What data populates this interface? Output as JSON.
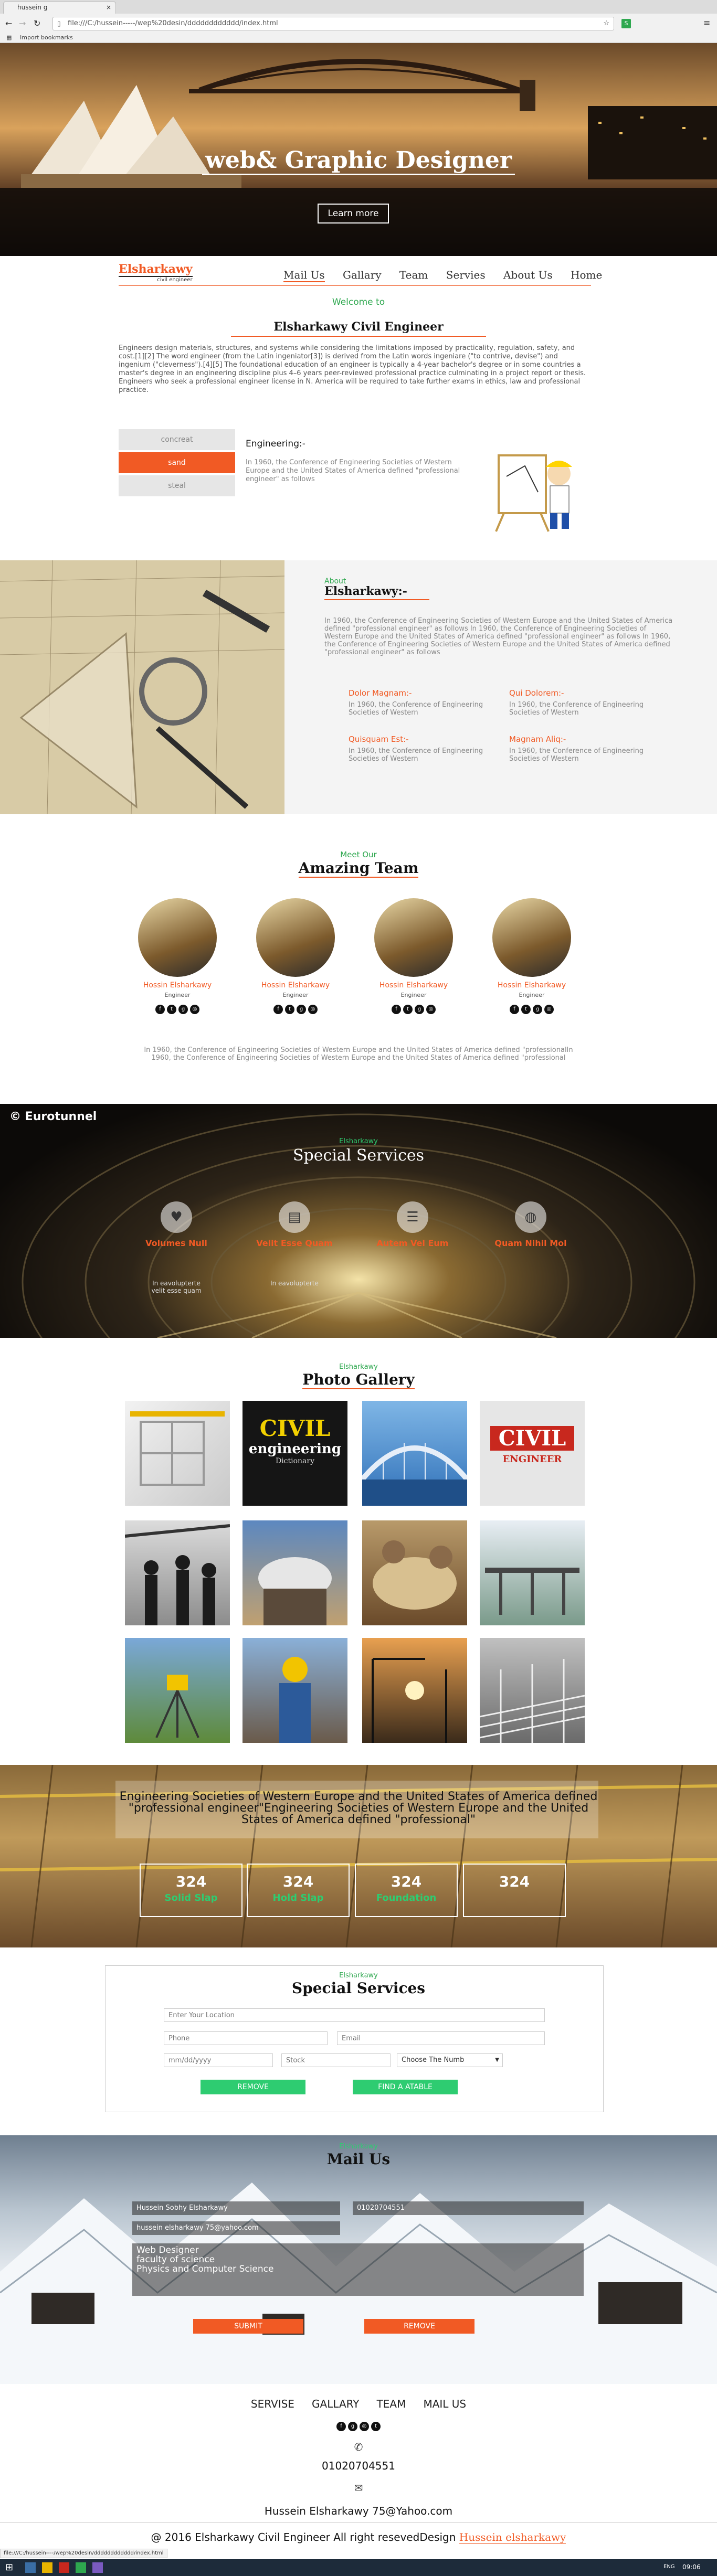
{
  "browser": {
    "tab_title": "hussein g",
    "address": "file:///C:/hussein-----/wep%20desin/dddddddddddd/index.html",
    "bookmark": "Import bookmarks"
  },
  "hero": {
    "title": "web& Graphic Designer",
    "learn_more": "Learn more"
  },
  "nav": {
    "logo": "Elsharkawy",
    "logo_sub": "civil engineer",
    "items": [
      "Mail Us",
      "Gallary",
      "Team",
      "Servies",
      "About Us",
      "Home"
    ]
  },
  "welcome": {
    "kicker": "Welcome to",
    "title": "Elsharkawy Civil Engineer",
    "paragraph": "Engineers design materials, structures, and systems while considering the limitations imposed by practicality, regulation, safety, and cost.[1][2] The word engineer (from the Latin ingeniator[3]) is derived from the Latin words ingeniare (\"to contrive, devise\") and ingenium (\"cleverness\").[4][5] The foundational education of an engineer is typically a 4-year bachelor's degree or in some countries a master's degree in an engineering discipline plus 4–6 years peer-reviewed professional practice culminating in a project report or thesis. Engineers who seek a professional engineer license in N. America will be required to take further exams in ethics, law and professional practice."
  },
  "tabs": {
    "items": [
      "concreat",
      "sand",
      "steal"
    ],
    "active_index": 1,
    "heading": "Engineering:-",
    "text": "In 1960, the Conference of Engineering Societies of Western Europe and the United States of America defined \"professional engineer\" as follows"
  },
  "about": {
    "kicker": "About",
    "title": "Elsharkawy:-",
    "paragraph": "In 1960, the Conference of Engineering Societies of Western Europe and the United States of America defined \"professional engineer\" as follows In 1960, the Conference of Engineering Societies of Western Europe and the United States of America defined \"professional engineer\" as follows In 1960, the Conference of Engineering Societies of Western Europe and the United States of America defined \"professional engineer\" as follows",
    "features": [
      {
        "title": "Dolor Magnam:-",
        "text": "In 1960, the Conference of Engineering Societies of Western"
      },
      {
        "title": "Qui Dolorem:-",
        "text": "In 1960, the Conference of Engineering Societies of Western"
      },
      {
        "title": "Quisquam Est:-",
        "text": "In 1960, the Conference of Engineering Societies of Western"
      },
      {
        "title": "Magnam Aliq:-",
        "text": "In 1960, the Conference of Engineering Societies of Western"
      }
    ]
  },
  "team": {
    "kicker": "Meet Our",
    "title": "Amazing Team",
    "members": [
      {
        "name": "Hossin Elsharkawy",
        "role": "Engineer"
      },
      {
        "name": "Hossin Elsharkawy",
        "role": "Engineer"
      },
      {
        "name": "Hossin Elsharkawy",
        "role": "Engineer"
      },
      {
        "name": "Hossin Elsharkawy",
        "role": "Engineer"
      }
    ],
    "paragraph": "In 1960, the Conference of Engineering Societies of Western Europe and the United States of America defined \"professionalIn 1960, the Conference of Engineering Societies of Western Europe and the United States of America defined \"professional"
  },
  "services": {
    "watermark": "© Eurotunnel",
    "kicker": "Elsharkawy",
    "title": "Special Services",
    "items": [
      {
        "title": "Volumes Null",
        "text": "In eavolupterte velit esse quam"
      },
      {
        "title": "Velit Esse Quam",
        "text": "In eavolupterte"
      },
      {
        "title": "Autem Vel Eum",
        "text": ""
      },
      {
        "title": "Quam Nihil Mol",
        "text": ""
      }
    ]
  },
  "gallery": {
    "kicker": "Elsharkawy",
    "title": "Photo Gallery",
    "tile_texts": [
      "CIVIL",
      "engineering",
      "Dictionary",
      "CIVIL",
      "ENGINEER"
    ]
  },
  "stats": {
    "heading": "Engineering Societies of Western Europe and the United States of America defined \"professional engineer\"Engineering Societies of Western Europe and the United States of America defined \"professional\"",
    "items": [
      {
        "value": "324",
        "label": "Solid Slap"
      },
      {
        "value": "324",
        "label": "Hold Slap"
      },
      {
        "value": "324",
        "label": "Foundation"
      },
      {
        "value": "324",
        "label": ""
      }
    ]
  },
  "form1": {
    "kicker": "Elsharkawy",
    "title": "Special Services",
    "location_ph": "Enter Your Location",
    "phone_ph": "Phone",
    "email_ph": "Email",
    "date_ph": "mm/dd/yyyy",
    "stock_ph": "Stock",
    "select_value": "Choose The Numb",
    "remove": "REMOVE",
    "find": "FIND A ATABLE"
  },
  "mail": {
    "kicker": "Elsharkawy",
    "title": "Mail Us",
    "name_val": "Hussein Sobhy Elsharkawy",
    "phone_val": "01020704551",
    "email_val": "hussein elsharkawy 75@yahoo.com",
    "message_lines": [
      "Web Designer",
      "faculty of science",
      "Physics and Computer Science"
    ],
    "submit": "SUBMIT",
    "remove": "REMOVE"
  },
  "footer": {
    "nav": [
      "SERVISE",
      "GALLARY",
      "TEAM",
      "MAIL US"
    ],
    "phone": "01020704551",
    "email": "Hussein Elsharkawy 75@Yahoo.com",
    "copyright": "@ 2016 Elsharkawy Civil Engineer All right resevedDesign",
    "designer": "Hussein elsharkawy"
  },
  "status": {
    "url": "file:///C:/hussein----/wep%20desin/dddddddddddd/index.html",
    "time": "09:06",
    "lang": "ENG"
  },
  "colors": {
    "accent": "#f15a24",
    "green": "#2ea84f",
    "button_green": "#2ecc71"
  }
}
